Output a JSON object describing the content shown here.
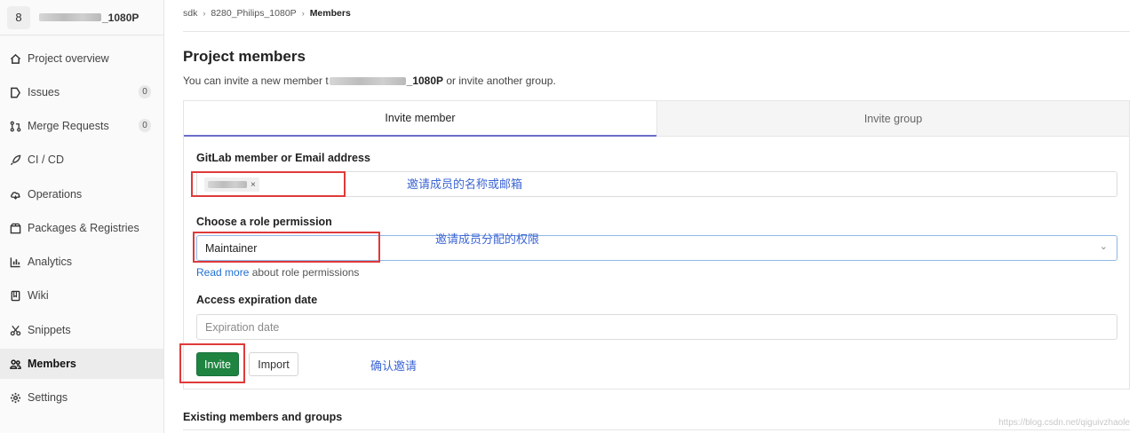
{
  "sidebar": {
    "project_avatar": "8",
    "project_name_suffix": "_1080P",
    "items": [
      {
        "label": "Project overview",
        "icon": "home-icon"
      },
      {
        "label": "Issues",
        "icon": "issues-icon",
        "count": "0"
      },
      {
        "label": "Merge Requests",
        "icon": "merge-request-icon",
        "count": "0"
      },
      {
        "label": "CI / CD",
        "icon": "rocket-icon"
      },
      {
        "label": "Operations",
        "icon": "cloud-icon"
      },
      {
        "label": "Packages & Registries",
        "icon": "package-icon"
      },
      {
        "label": "Analytics",
        "icon": "chart-icon"
      },
      {
        "label": "Wiki",
        "icon": "book-icon"
      },
      {
        "label": "Snippets",
        "icon": "scissors-icon"
      },
      {
        "label": "Members",
        "icon": "users-icon",
        "active": true
      },
      {
        "label": "Settings",
        "icon": "gear-icon"
      }
    ]
  },
  "breadcrumb": {
    "items": [
      "sdk",
      "8280_Philips_1080P",
      "Members"
    ],
    "separator": "›"
  },
  "page": {
    "title": "Project members",
    "subtitle_prefix": "You can invite a new member t",
    "subtitle_project": "_1080P",
    "subtitle_suffix": " or invite another group."
  },
  "tabs": {
    "invite_member": "Invite member",
    "invite_group": "Invite group"
  },
  "form": {
    "member_label": "GitLab member or Email address",
    "token_remove": "×",
    "role_label": "Choose a role permission",
    "role_value": "Maintainer",
    "role_chevron": "⌄",
    "read_more_link": "Read more",
    "read_more_rest": " about role permissions",
    "expiration_label": "Access expiration date",
    "expiration_placeholder": "Expiration date",
    "invite_button": "Invite",
    "import_button": "Import"
  },
  "annotations": {
    "member_note": "邀请成员的名称或邮箱",
    "role_note": "邀请成员分配的权限",
    "invite_note": "确认邀请"
  },
  "existing_title": "Existing members and groups",
  "watermark": "https://blog.csdn.net/qiguivzhaole",
  "colors": {
    "accent_tab": "#6b6dc9",
    "invite_green": "#1f8440",
    "annotation_box": "#e03a3a",
    "annotation_text": "#3d66d4",
    "link": "#1f6fd1"
  }
}
